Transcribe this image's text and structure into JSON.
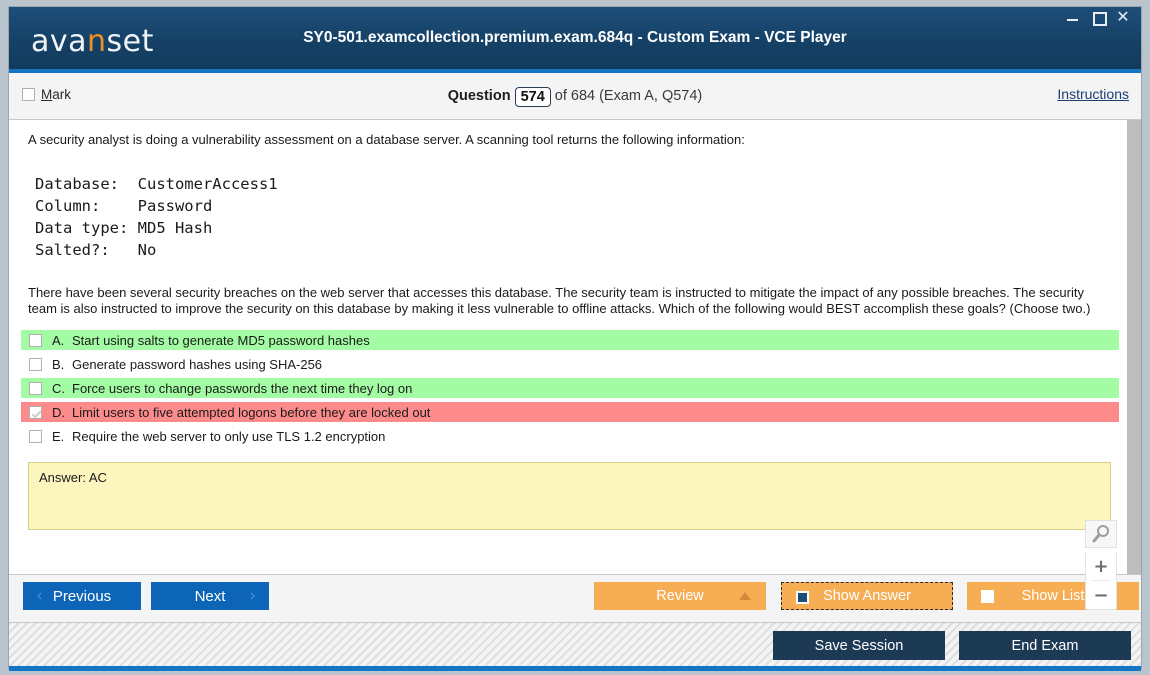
{
  "window": {
    "logo_left": "ava",
    "logo_highlight": "n",
    "logo_right": "set",
    "title": "SY0-501.examcollection.premium.exam.684q - Custom Exam - VCE Player",
    "controls": {
      "minimize": "minimize-icon",
      "maximize": "maximize-icon",
      "close": "✕"
    },
    "accent_blue": "#1475c4",
    "header_navy": "#164268"
  },
  "question_header": {
    "mark_label_prefix": "M",
    "mark_label_rest": "ark",
    "question_word": "Question",
    "question_number": "574",
    "of_text": "of 684 (Exam A, Q574)",
    "instructions": "Instructions"
  },
  "question": {
    "intro": "A security analyst is doing a vulnerability assessment on a database server. A scanning tool returns the following information:",
    "scan_block": "Database:  CustomerAccess1\nColumn:    Password\nData type: MD5 Hash\nSalted?:   No",
    "body": "There have been several security breaches on the web server that accesses this database. The security team is instructed to mitigate the impact of any possible breaches. The security team is also instructed to improve the security on this database by making it less vulnerable to offline attacks. Which of the following would BEST accomplish these goals? (Choose two.)",
    "options": [
      {
        "letter": "A.",
        "text": "Start using salts to generate MD5 password hashes",
        "state": "correct",
        "checked": false
      },
      {
        "letter": "B.",
        "text": "Generate password hashes using SHA-256",
        "state": "none",
        "checked": false
      },
      {
        "letter": "C.",
        "text": "Force users to change passwords the next time they log on",
        "state": "correct",
        "checked": false
      },
      {
        "letter": "D.",
        "text": "Limit users to five attempted logons before they are locked out",
        "state": "wrong",
        "checked": true
      },
      {
        "letter": "E.",
        "text": "Require the web server to only use TLS 1.2 encryption",
        "state": "none",
        "checked": false
      }
    ],
    "answer_text": "Answer: AC",
    "colors": {
      "correct_bg": "#a3fca3",
      "wrong_bg": "#fd8b8b",
      "answer_bg": "#fcf5bd"
    }
  },
  "zoom_widget": {
    "magnifier": "search-icon",
    "zoom_in": "+",
    "zoom_out": "−"
  },
  "nav": {
    "previous": "Previous",
    "next": "Next",
    "prev_chevron": "‹",
    "next_chevron": "›",
    "review": "Review",
    "show_answer": "Show Answer",
    "show_list": "Show List",
    "show_answer_checked": true,
    "show_list_checked": false
  },
  "status": {
    "save_session": "Save Session",
    "end_exam": "End Exam"
  }
}
